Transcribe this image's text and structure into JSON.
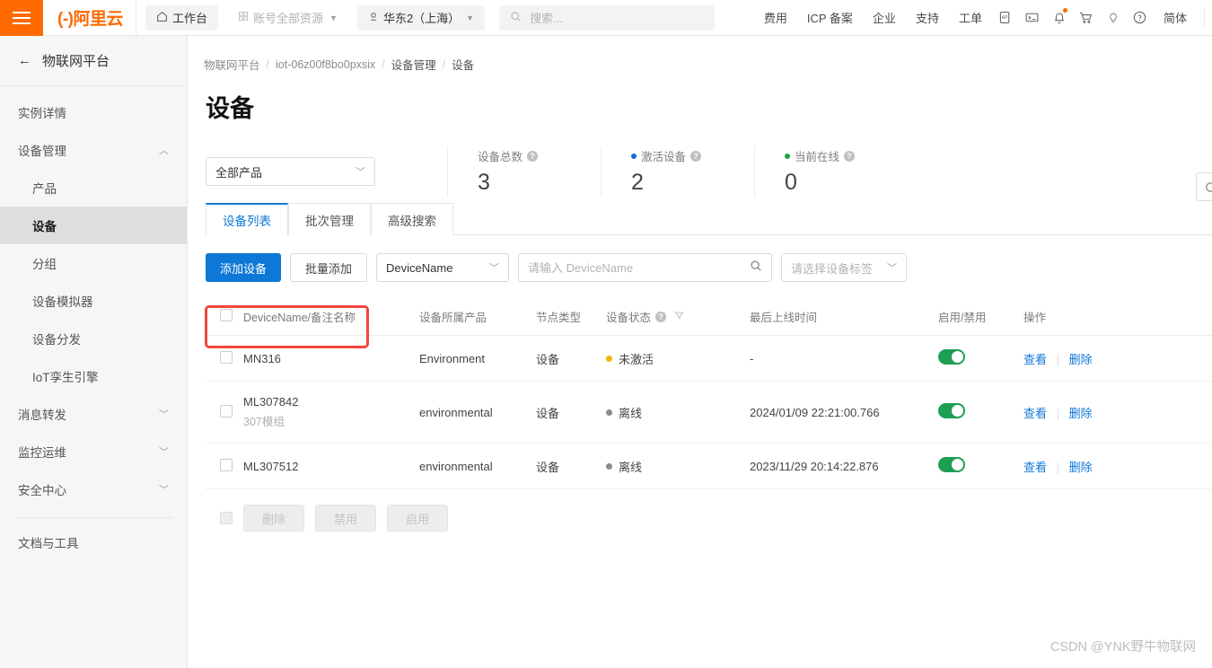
{
  "topnav": {
    "logo_text": "(-)阿里云",
    "workbench": "工作台",
    "all_resources": "账号全部资源",
    "region": "华东2（上海）",
    "search_placeholder": "搜索...",
    "links": [
      "费用",
      "ICP 备案",
      "企业",
      "支持",
      "工单"
    ],
    "icons": [
      "app-icon",
      "terminal-icon",
      "bell-icon",
      "cart-icon",
      "bulb-icon",
      "help-icon"
    ],
    "language": "简体"
  },
  "sidebar": {
    "header": "物联网平台",
    "items": [
      {
        "label": "实例详情",
        "level": "top",
        "state": "normal"
      },
      {
        "label": "设备管理",
        "level": "top",
        "state": "expanded"
      },
      {
        "label": "产品",
        "level": "sub",
        "state": "normal"
      },
      {
        "label": "设备",
        "level": "sub",
        "state": "active"
      },
      {
        "label": "分组",
        "level": "sub",
        "state": "normal"
      },
      {
        "label": "设备模拟器",
        "level": "sub",
        "state": "normal"
      },
      {
        "label": "设备分发",
        "level": "sub",
        "state": "normal"
      },
      {
        "label": "IoT孪生引擎",
        "level": "sub",
        "state": "normal"
      },
      {
        "label": "消息转发",
        "level": "top",
        "state": "collapsed"
      },
      {
        "label": "监控运维",
        "level": "top",
        "state": "collapsed"
      },
      {
        "label": "安全中心",
        "level": "top",
        "state": "collapsed"
      },
      {
        "label": "文档与工具",
        "level": "top",
        "state": "normal"
      }
    ]
  },
  "breadcrumb": [
    "物联网平台",
    "iot-06z00f8bo0pxsix",
    "设备管理",
    "设备"
  ],
  "page_title": "设备",
  "product_filter": {
    "value": "全部产品"
  },
  "stats": [
    {
      "label": "设备总数",
      "value": "3",
      "dot_color": ""
    },
    {
      "label": "激活设备",
      "value": "2",
      "dot_color": "#1668dc"
    },
    {
      "label": "当前在线",
      "value": "0",
      "dot_color": "#19a447"
    }
  ],
  "tabs": [
    {
      "label": "设备列表",
      "active": true
    },
    {
      "label": "批次管理",
      "active": false
    },
    {
      "label": "高级搜索",
      "active": false
    }
  ],
  "toolbar": {
    "add_device": "添加设备",
    "batch_add": "批量添加",
    "search_field": "DeviceName",
    "search_placeholder": "请输入 DeviceName",
    "tag_select": "请选择设备标签"
  },
  "table": {
    "headers": [
      "DeviceName/备注名称",
      "设备所属产品",
      "节点类型",
      "设备状态",
      "最后上线时间",
      "启用/禁用",
      "操作"
    ],
    "rows": [
      {
        "name": "MN316",
        "subname": "",
        "product": "Environment",
        "node_type": "设备",
        "state": "未激活",
        "state_color": "#f5b50a",
        "last_online": "-",
        "enabled": true,
        "ops": [
          "查看",
          "删除"
        ],
        "highlighted": true
      },
      {
        "name": "ML307842",
        "subname": "307模组",
        "product": "environmental",
        "node_type": "设备",
        "state": "离线",
        "state_color": "#8c8c8c",
        "last_online": "2024/01/09 22:21:00.766",
        "enabled": true,
        "ops": [
          "查看",
          "删除"
        ],
        "highlighted": false
      },
      {
        "name": "ML307512",
        "subname": "",
        "product": "environmental",
        "node_type": "设备",
        "state": "离线",
        "state_color": "#8c8c8c",
        "last_online": "2023/11/29 20:14:22.876",
        "enabled": true,
        "ops": [
          "查看",
          "删除"
        ],
        "highlighted": false
      }
    ]
  },
  "bulk_actions": [
    "删除",
    "禁用",
    "启用"
  ],
  "watermark": "CSDN @YNK野牛物联网",
  "colors": {
    "brand_orange": "#ff6a00",
    "primary_blue": "#0d78d6",
    "toggle_green": "#1e9e52",
    "highlight_red": "#f4453a"
  }
}
